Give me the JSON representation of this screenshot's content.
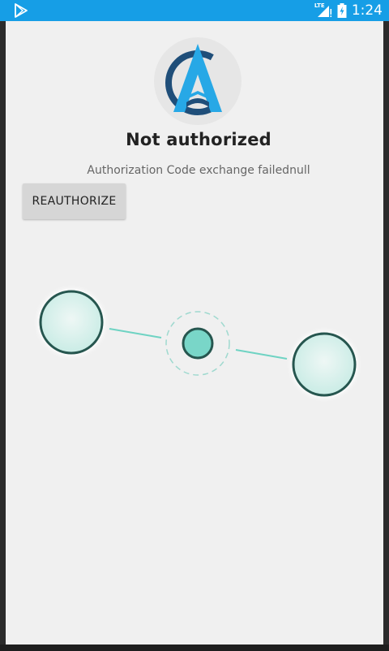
{
  "status_bar": {
    "app_icon": "play-store-icon",
    "network_label": "LTE",
    "signal_icon": "cell-signal-icon",
    "battery_icon": "battery-charging-icon",
    "time": "1:24",
    "color": "#169ee6"
  },
  "app": {
    "logo_icon": "app-a-logo-icon",
    "title": "Not authorized",
    "message": "Authorization Code exchange failednull",
    "reauthorize_button": "REAUTHORIZE"
  },
  "colors": {
    "background": "#f0f0f0",
    "node_fill": "#d4efeb",
    "node_stroke": "#26564f",
    "center_fill": "#79d6c8",
    "connector": "#6fd3c3"
  }
}
